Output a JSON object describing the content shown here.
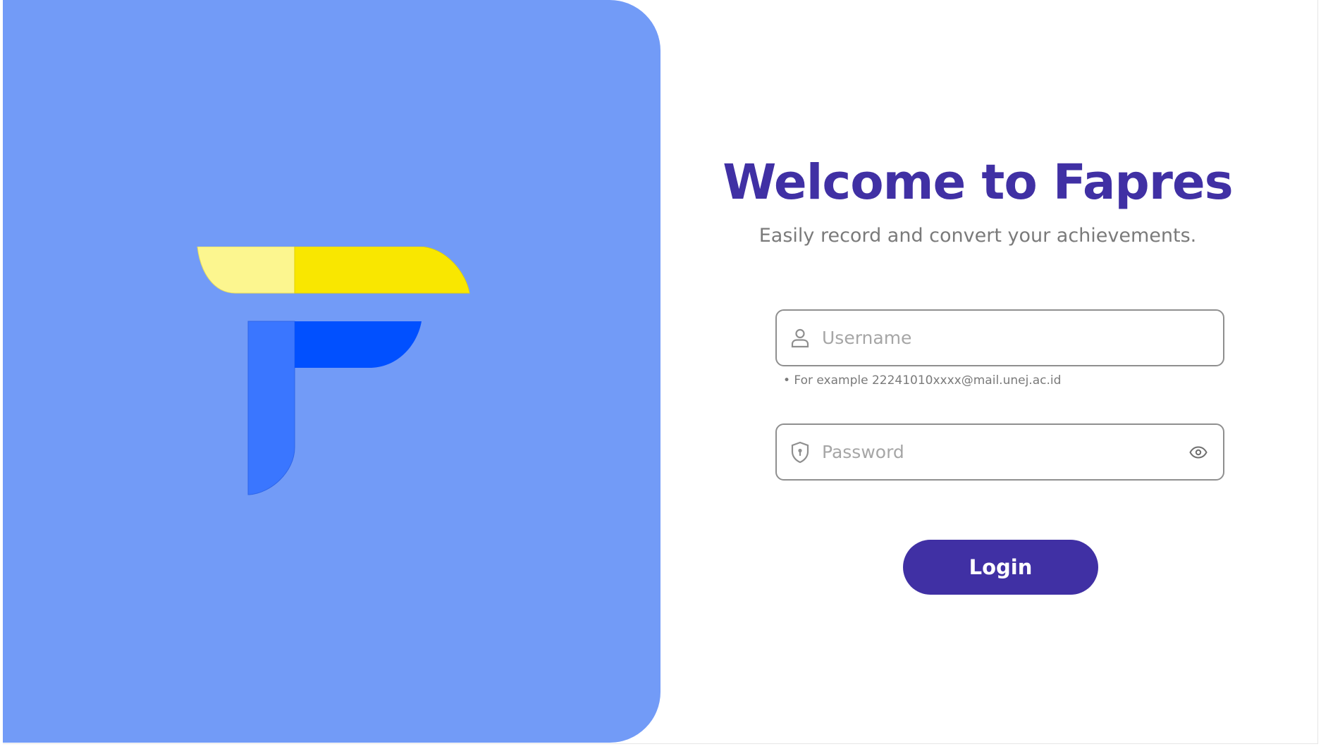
{
  "colors": {
    "brand_panel": "#729bf7",
    "accent": "#4030a4",
    "logo_yellow_light": "#fcf68f",
    "logo_yellow": "#f9e700",
    "logo_blue_light": "#3a76ff",
    "logo_blue": "#0150ff"
  },
  "logo": {
    "icon": "fapres-f-logo"
  },
  "login": {
    "title": "Welcome to Fapres",
    "subtitle": "Easily record and convert your achievements.",
    "username": {
      "icon": "user-icon",
      "placeholder": "Username",
      "value": "",
      "hint": "• For example 22241010xxxx@mail.unej.ac.id"
    },
    "password": {
      "icon": "shield-lock-icon",
      "placeholder": "Password",
      "value": "",
      "toggle_icon": "eye-icon"
    },
    "button_label": "Login"
  }
}
